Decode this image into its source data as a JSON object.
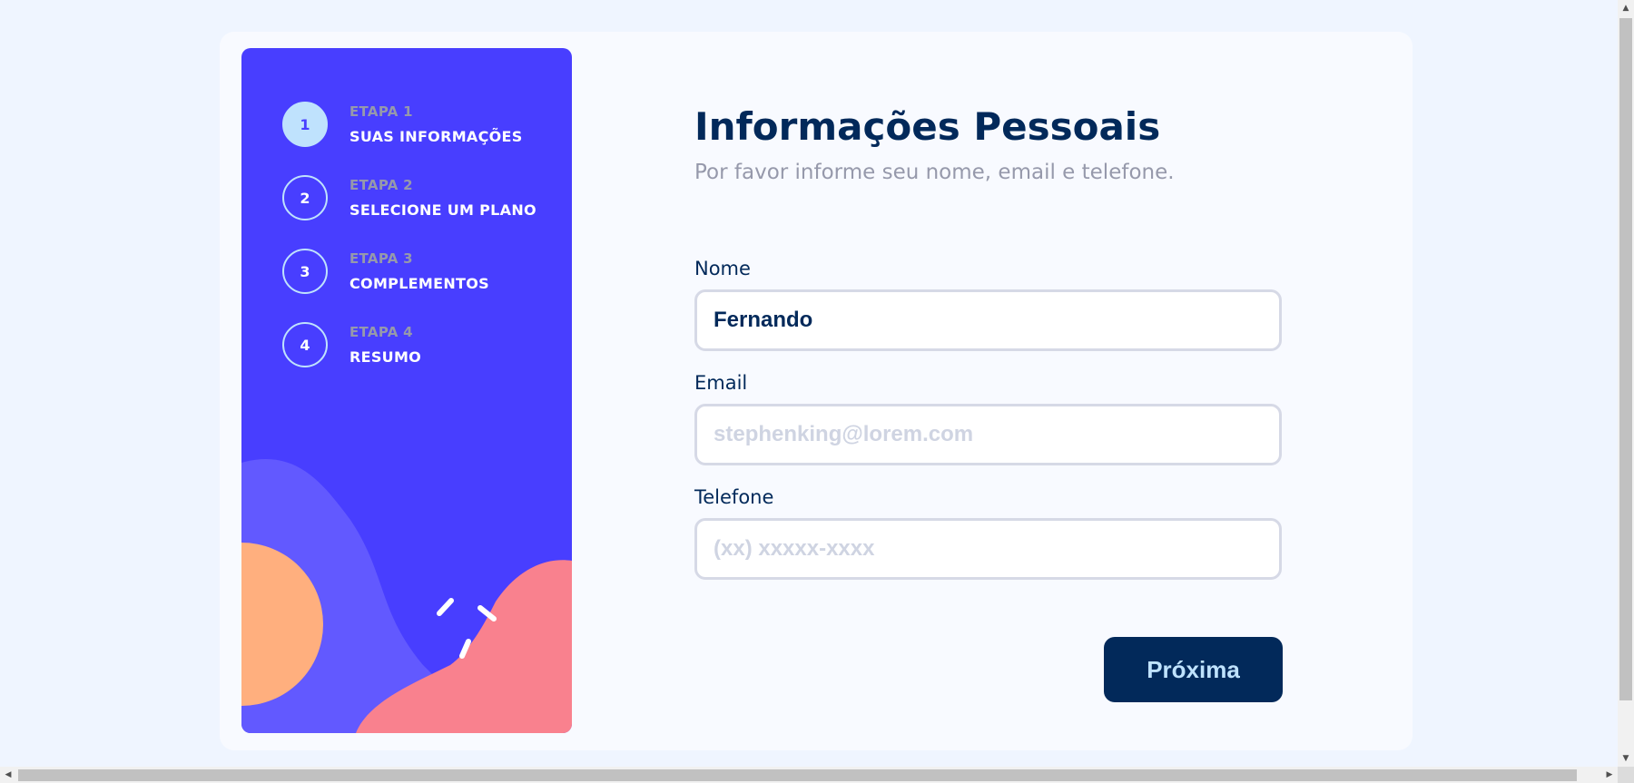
{
  "sidebar": {
    "steps": [
      {
        "number": "1",
        "label": "ETAPA 1",
        "title": "SUAS INFORMAÇÕES",
        "active": true
      },
      {
        "number": "2",
        "label": "ETAPA 2",
        "title": "SELECIONE UM PLANO",
        "active": false
      },
      {
        "number": "3",
        "label": "ETAPA 3",
        "title": "COMPLEMENTOS",
        "active": false
      },
      {
        "number": "4",
        "label": "ETAPA 4",
        "title": "RESUMO",
        "active": false
      }
    ]
  },
  "main": {
    "title": "Informações Pessoais",
    "subtitle": "Por favor informe seu nome, email e telefone.",
    "fields": {
      "name": {
        "label": "Nome",
        "value": "Fernando",
        "placeholder": ""
      },
      "email": {
        "label": "Email",
        "value": "",
        "placeholder": "stephenking@lorem.com"
      },
      "phone": {
        "label": "Telefone",
        "value": "",
        "placeholder": "(xx) xxxxx-xxxx"
      }
    },
    "next_label": "Próxima"
  },
  "colors": {
    "sidebar_bg": "#483eff",
    "active_step": "#bfe2fd",
    "title": "#02295a",
    "muted": "#9699ab",
    "border": "#d6d9e6",
    "button_bg": "#02295a",
    "button_text": "#bfe2fd"
  },
  "icons": {
    "scroll_up": "▲",
    "scroll_down": "▼",
    "scroll_left": "◀",
    "scroll_right": "▶"
  }
}
